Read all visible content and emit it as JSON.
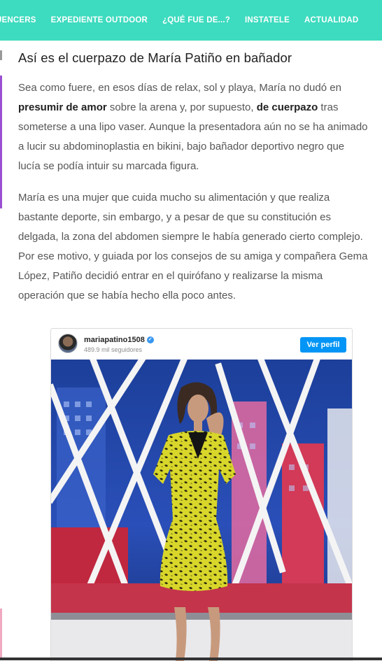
{
  "nav": {
    "items": [
      "UENCERS",
      "EXPEDIENTE OUTDOOR",
      "¿QUÉ FUE DE...?",
      "INSTATELE",
      "ACTUALIDAD"
    ]
  },
  "article": {
    "heading": "Así es el cuerpazo de María Patiño en bañador",
    "p1": {
      "line1": "Sea como fuere, en esos días de relax, sol y playa, María no dudó en",
      "line2_bold1": "presumir de amor",
      "line2_mid": " sobre la arena y, por supuesto, ",
      "line2_bold2": "de cuerpazo",
      "line2_end": " tras",
      "line3": "someterse a una lipo vaser. Aunque la presentadora aún no se ha animado",
      "line4": "a lucir su abdominoplastia en bikini, bajo bañador deportivo negro que",
      "line5": "lucía se podía intuir su marcada figura."
    },
    "p2": {
      "line1": "María es una mujer que cuida mucho su alimentación y que realiza",
      "line2": "bastante deporte, sin embargo, y a pesar de que su constitución es",
      "line3": "delgada, la zona del abdomen siempre le había generado cierto complejo.",
      "line4": "Por ese motivo, y guiada por los consejos de su amiga y compañera Gema",
      "line5": "López, Patiño decidió entrar en el quirófano y realizarse la misma",
      "line6": "operación que se había hecho ella poco antes."
    }
  },
  "embed": {
    "username": "mariapatino1508",
    "followers": "489.9 mil seguidores",
    "button": "Ver perfil",
    "verified_icon": "✓"
  },
  "colors": {
    "nav_bg": "#3ddbbf",
    "button_bg": "#0095f6",
    "accent_purple": "#9b4fd0"
  }
}
